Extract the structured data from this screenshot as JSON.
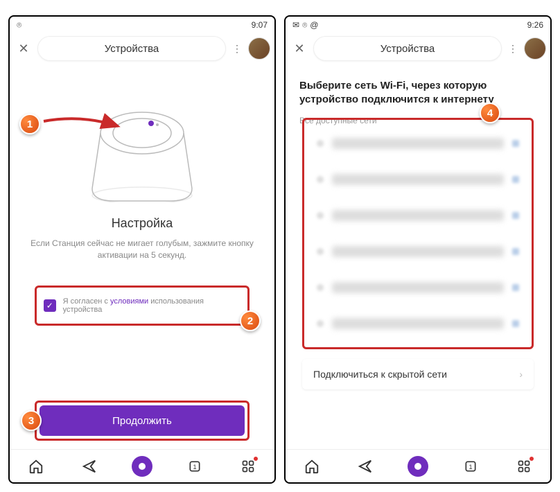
{
  "left": {
    "statusbar_time": "9:07",
    "header_title": "Устройства",
    "setup_title": "Настройка",
    "setup_desc": "Если Станция сейчас не мигает голубым, зажмите кнопку активации на 5 секунд.",
    "agree_prefix": "Я согласен с ",
    "agree_link": "условиями",
    "agree_suffix": " использования устройства",
    "continue_label": "Продолжить"
  },
  "right": {
    "statusbar_time": "9:26",
    "header_title": "Устройства",
    "wifi_title": "Выберите сеть Wi-Fi, через которую устройство подключится к интернету",
    "wifi_subtitle": "Все доступные сети",
    "hidden_label": "Подключиться к скрытой сети"
  },
  "callouts": {
    "c1": "1",
    "c2": "2",
    "c3": "3",
    "c4": "4"
  }
}
